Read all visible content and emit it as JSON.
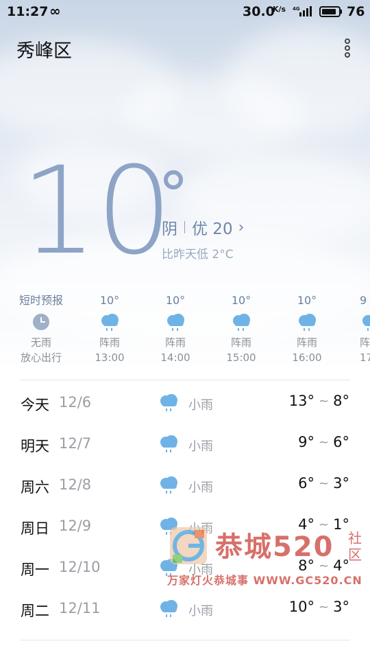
{
  "status_bar": {
    "time": "11:27",
    "link_symbol": "∞",
    "net_speed": "30.0",
    "net_speed_unit": "K/s",
    "network_type": "4G",
    "battery": "76"
  },
  "header": {
    "city": "秀峰区",
    "menu_icon": "more-vertical-icon"
  },
  "current": {
    "temperature": "10",
    "condition": "阴",
    "aqi_label": "优 20",
    "comparison": "比昨天低 2°C"
  },
  "hourly": [
    {
      "top": "短时预报",
      "icon": "clock-icon",
      "condition": "无雨",
      "time": "放心出行"
    },
    {
      "top": "10°",
      "icon": "shower-icon",
      "condition": "阵雨",
      "time": "13:00"
    },
    {
      "top": "10°",
      "icon": "shower-icon",
      "condition": "阵雨",
      "time": "14:00"
    },
    {
      "top": "10°",
      "icon": "shower-icon",
      "condition": "阵雨",
      "time": "15:00"
    },
    {
      "top": "10°",
      "icon": "shower-icon",
      "condition": "阵雨",
      "time": "16:00"
    },
    {
      "top": "9",
      "icon": "shower-icon",
      "condition": "阵",
      "time": "17"
    }
  ],
  "daily": [
    {
      "day": "今天",
      "date": "12/6",
      "condition": "小雨",
      "high": "13°",
      "tilde": "~",
      "low": "8°"
    },
    {
      "day": "明天",
      "date": "12/7",
      "condition": "小雨",
      "high": "9°",
      "tilde": "~",
      "low": "6°"
    },
    {
      "day": "周六",
      "date": "12/8",
      "condition": "小雨",
      "high": "6°",
      "tilde": "~",
      "low": "3°"
    },
    {
      "day": "周日",
      "date": "12/9",
      "condition": "小雨",
      "high": "4°",
      "tilde": "~",
      "low": "1°"
    },
    {
      "day": "周一",
      "date": "12/10",
      "condition": "小雨",
      "high": "8°",
      "tilde": "~",
      "low": "4°"
    },
    {
      "day": "周二",
      "date": "12/11",
      "condition": "小雨",
      "high": "10°",
      "tilde": "~",
      "low": "3°"
    }
  ],
  "watermark": {
    "title": "恭城520",
    "side": "社区",
    "subtitle": "万家灯火恭城事 WWW.GC520.CN"
  },
  "colors": {
    "accent_temp": "#8ea4c6",
    "rain_icon": "#6fb3e6",
    "watermark": "#c83a32"
  }
}
